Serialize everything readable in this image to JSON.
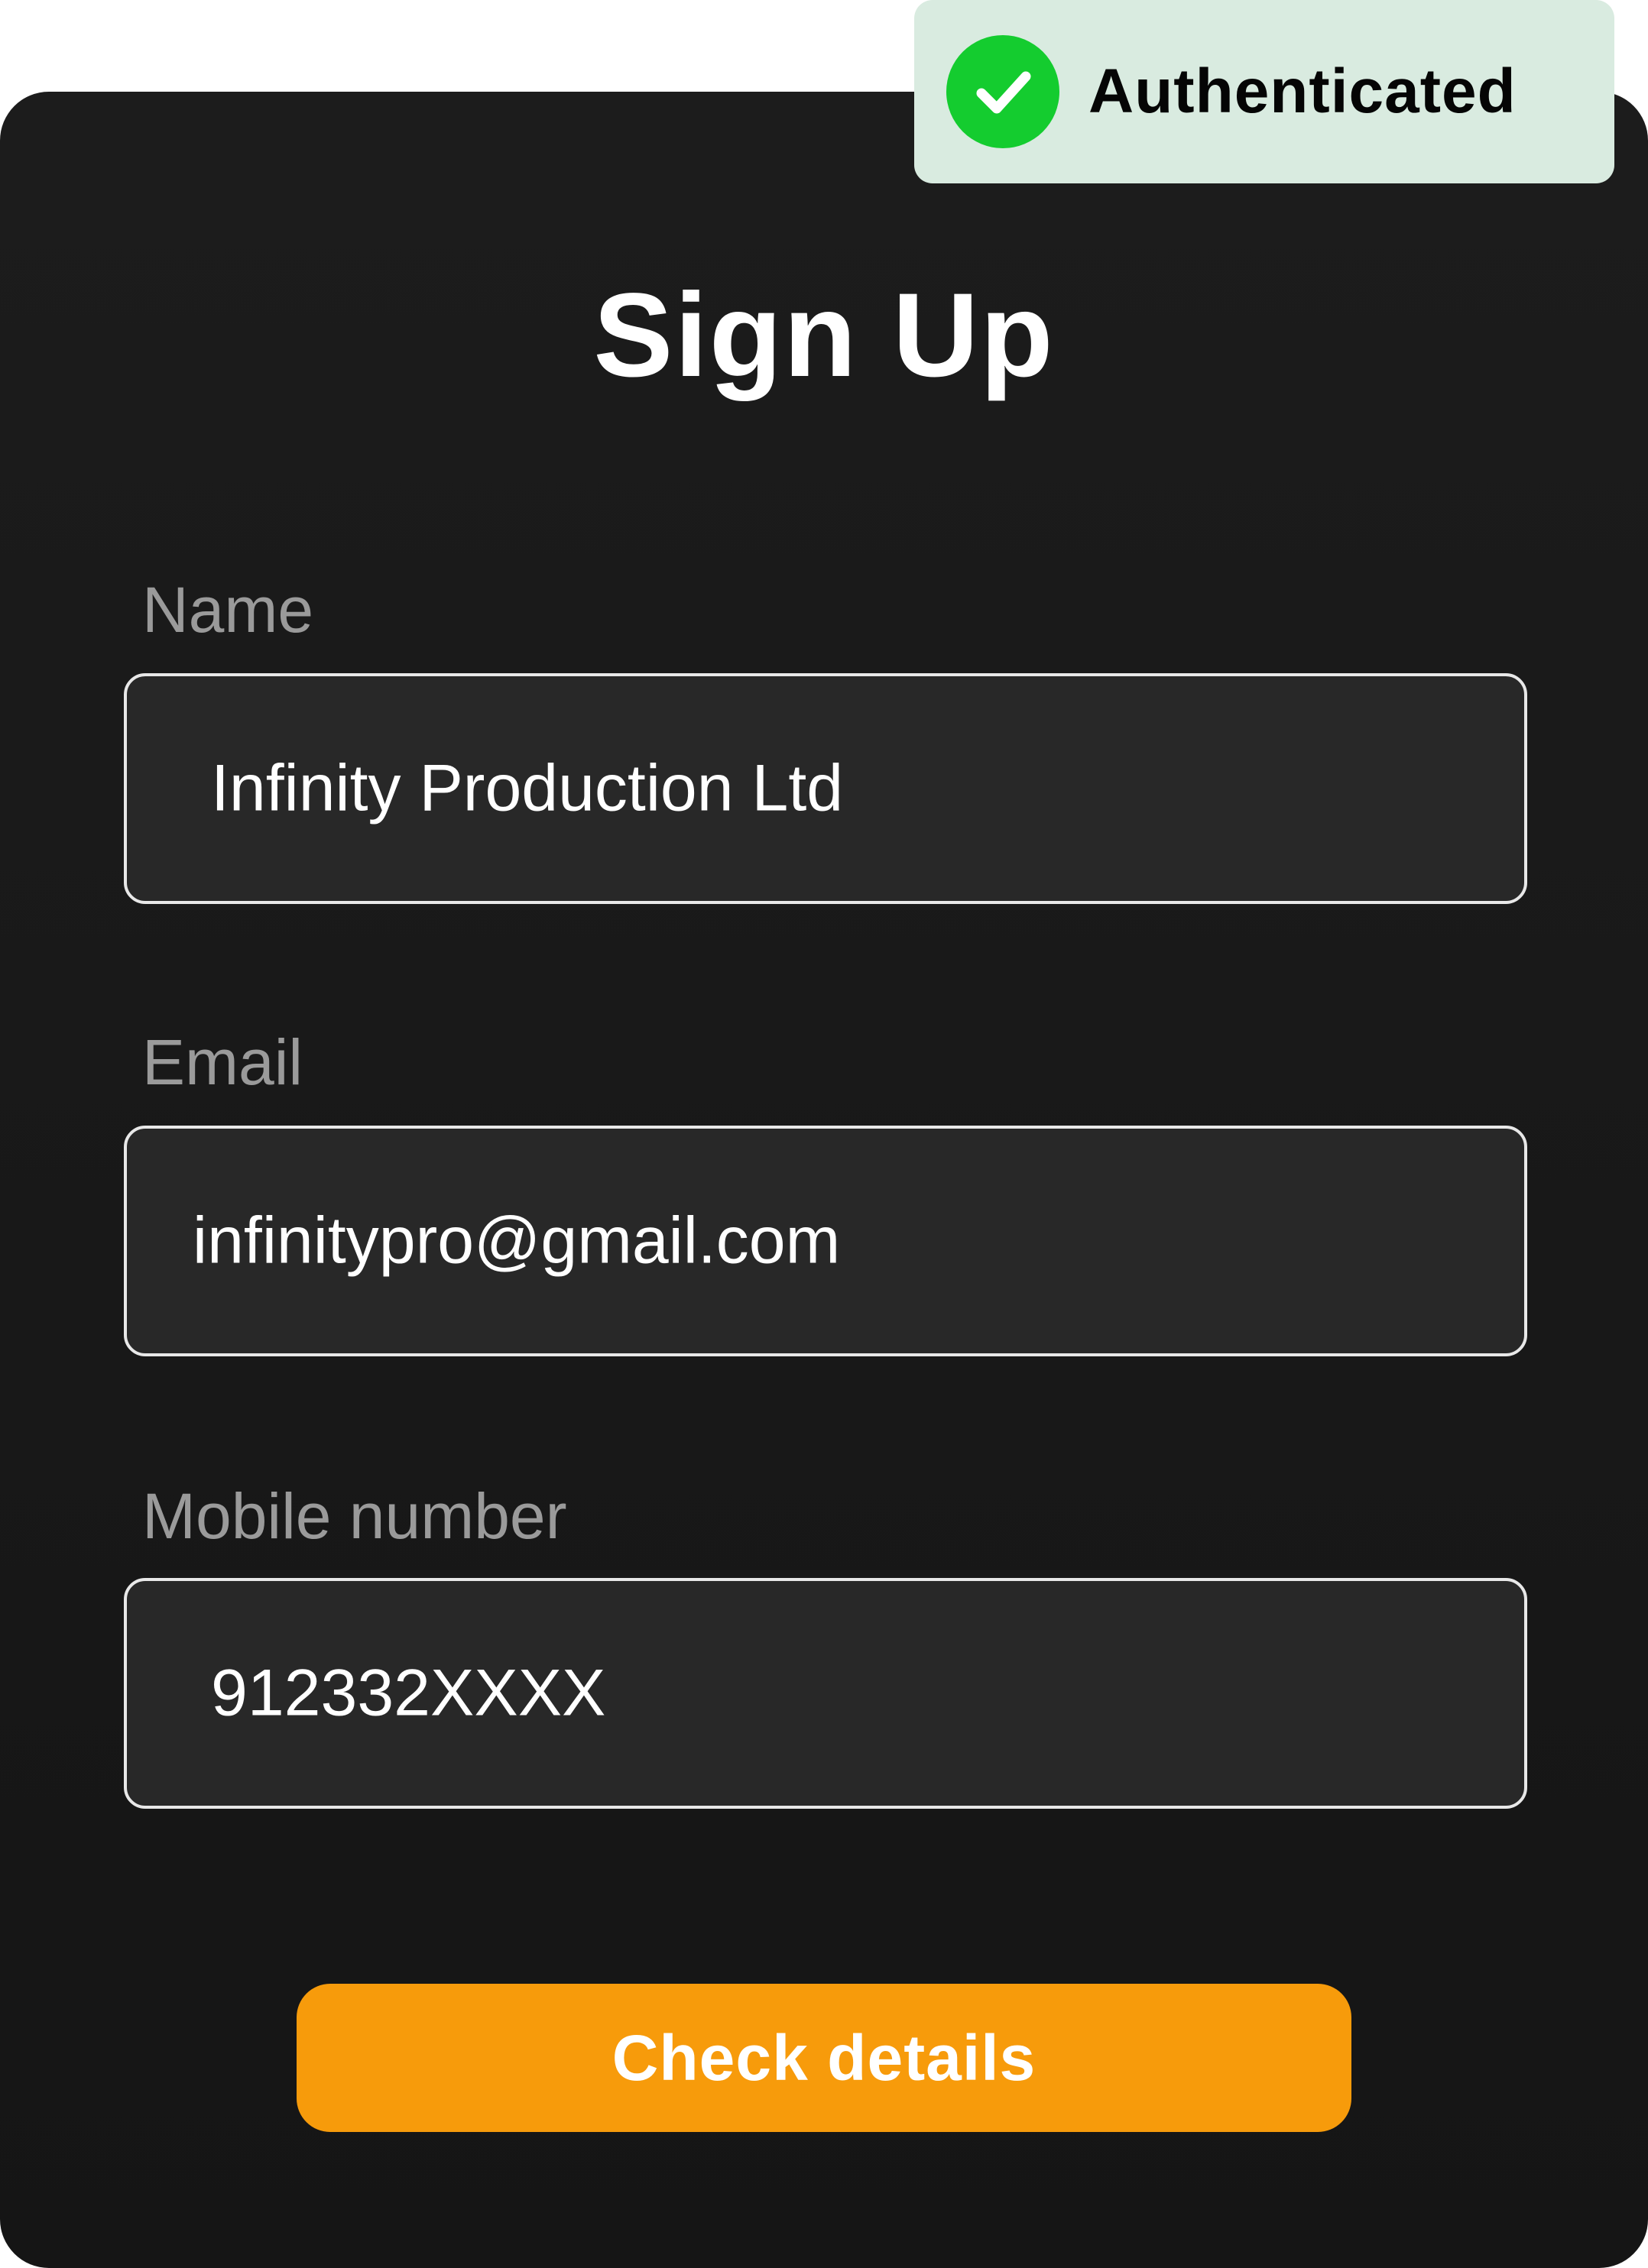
{
  "badge": {
    "icon": "check-circle-icon",
    "text": "Authenticated",
    "icon_color": "#14CC2F",
    "background": "#D9EBE0"
  },
  "form": {
    "title": "Sign Up",
    "fields": [
      {
        "label": "Name",
        "value": "Infinity Production Ltd"
      },
      {
        "label": "Email",
        "value": "infinitypro@gmail.com"
      },
      {
        "label": "Mobile number",
        "value": "912332XXXX"
      }
    ],
    "submit_label": "Check details"
  },
  "colors": {
    "card_background": "#181818",
    "field_background": "#282828",
    "field_border": "#E8E8E8",
    "label_text": "#9A9A9A",
    "accent": "#F79B0B"
  }
}
